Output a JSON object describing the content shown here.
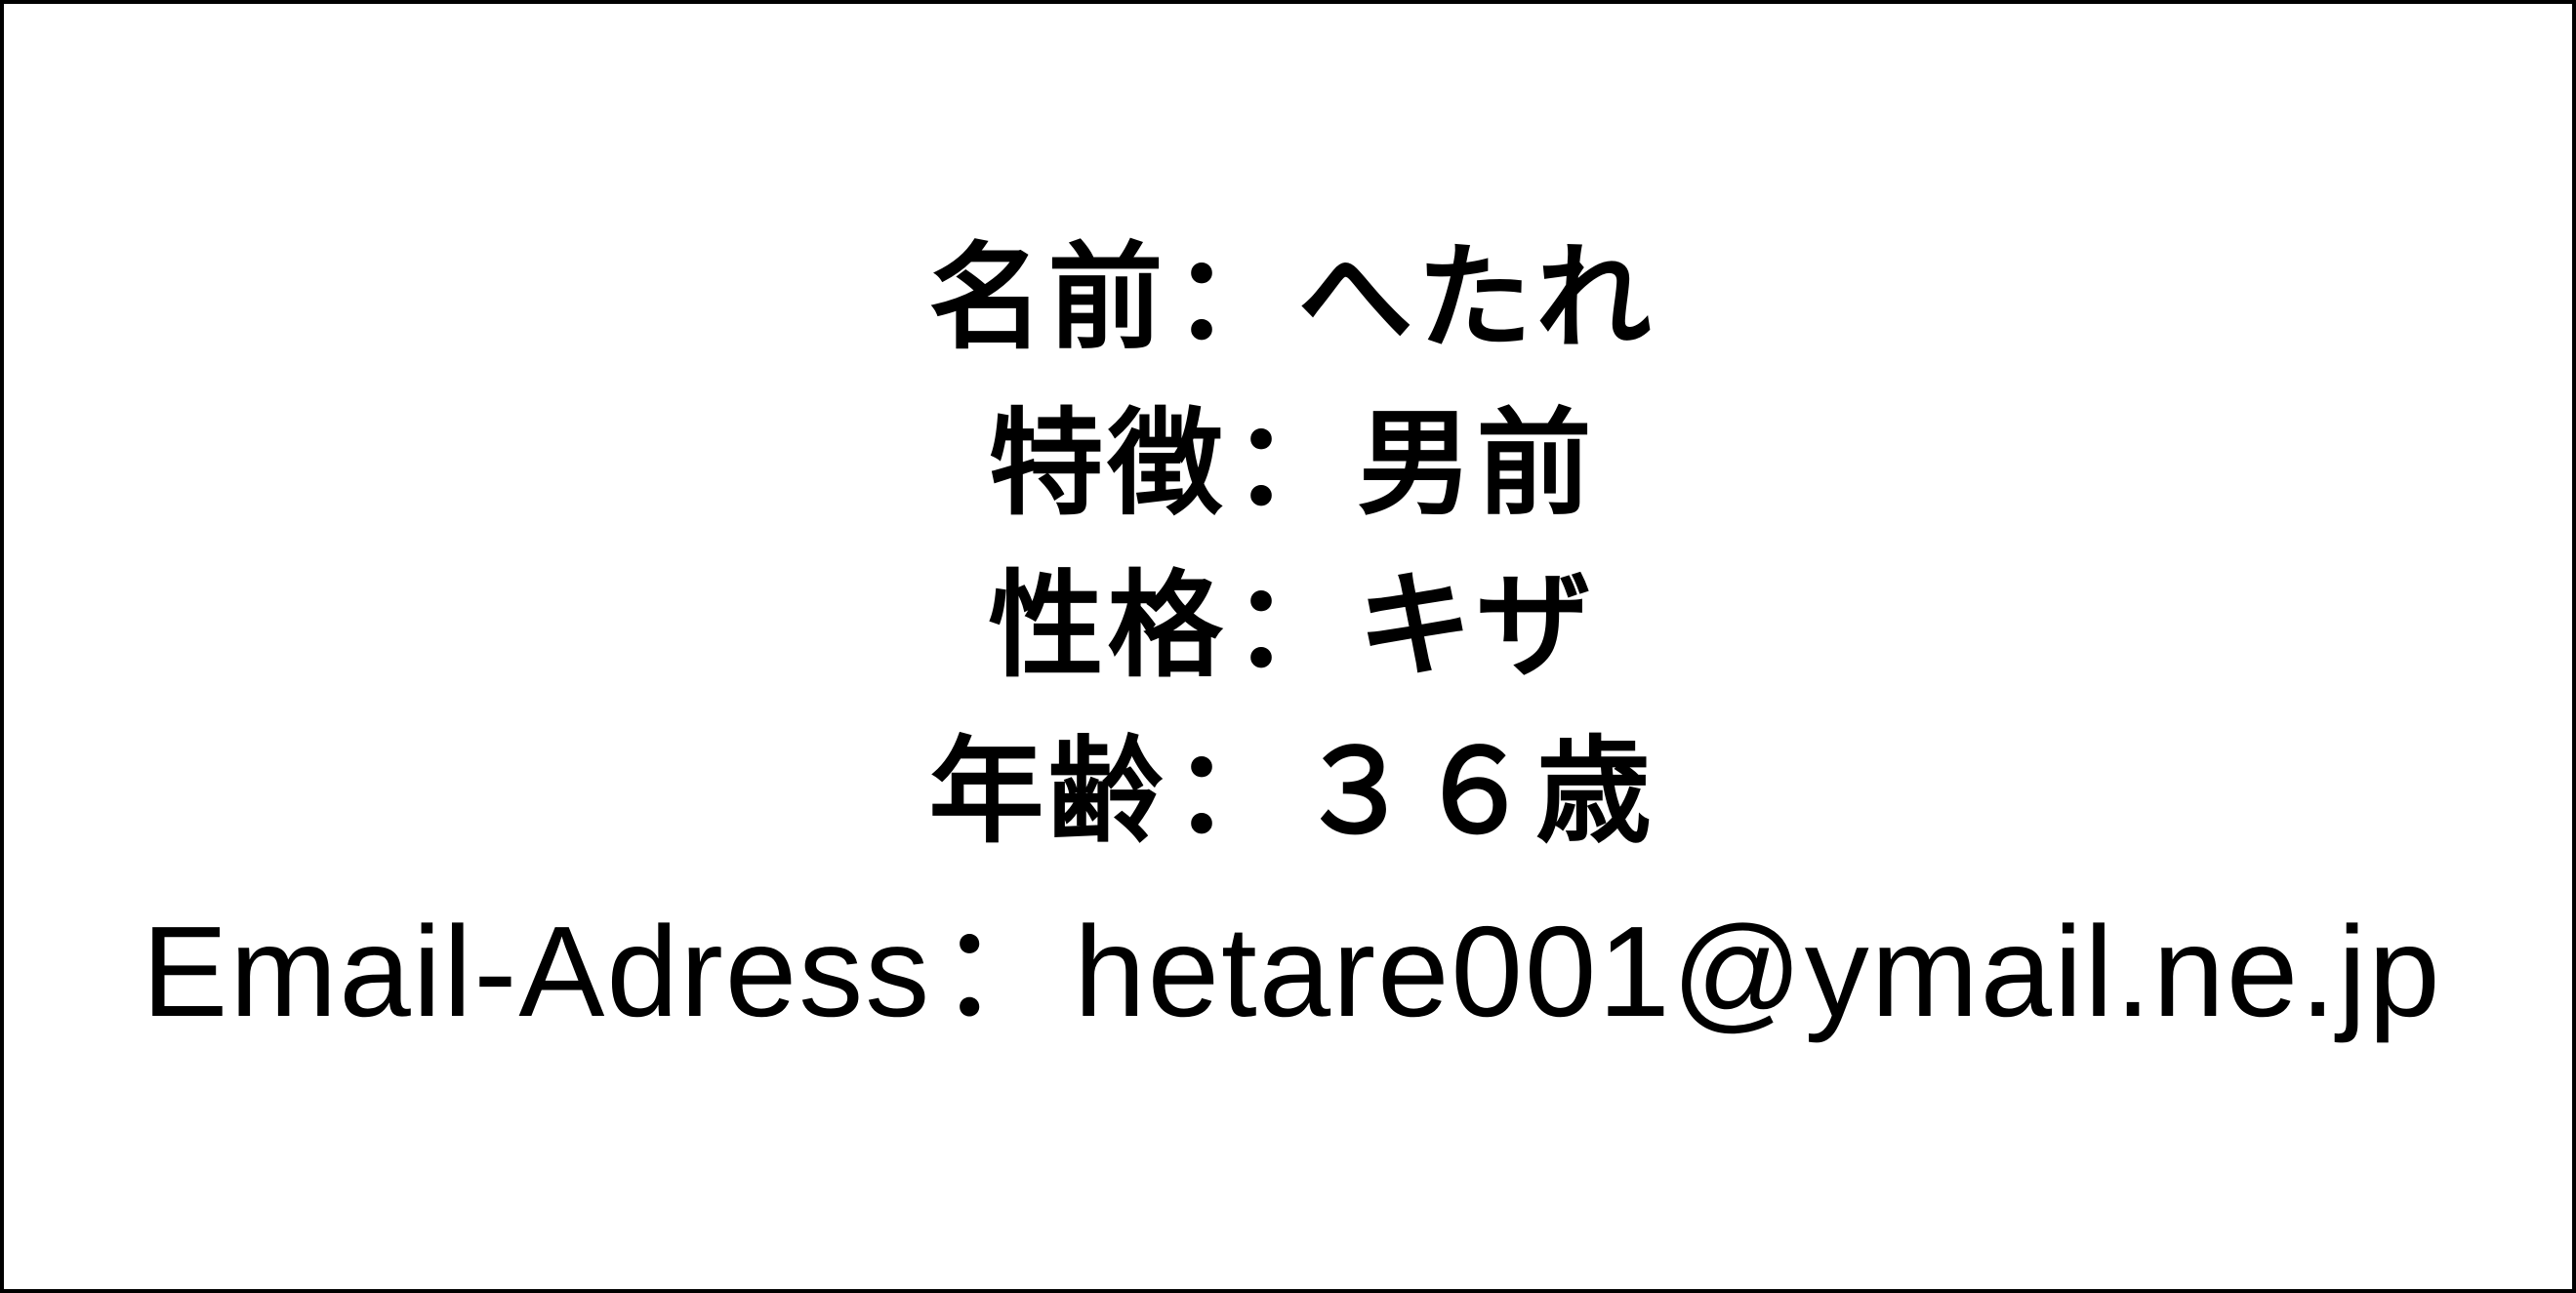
{
  "profile": {
    "separator": "：",
    "name": {
      "label": "名前",
      "value": "へたれ"
    },
    "feature": {
      "label": "特徴",
      "value": "男前"
    },
    "personality": {
      "label": "性格",
      "value": "キザ"
    },
    "age": {
      "label": "年齢",
      "value": "３６歳"
    },
    "email": {
      "label": "Email-Adress",
      "value": "hetare001@ymail.ne.jp"
    }
  }
}
